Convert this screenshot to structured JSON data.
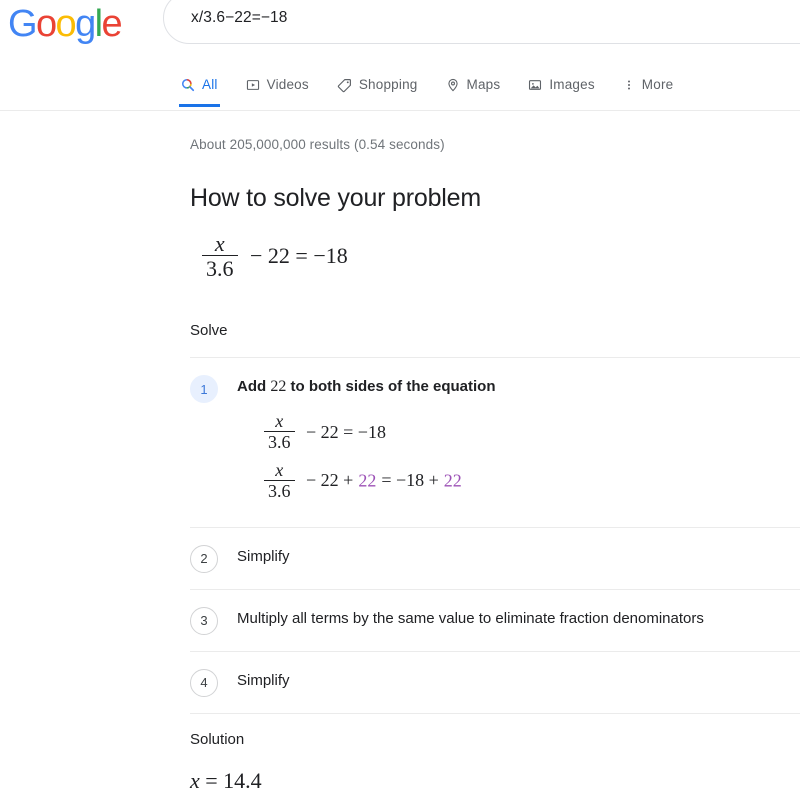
{
  "brand": {
    "name": "Google",
    "letters": [
      {
        "char": "G",
        "color": "#4285f4"
      },
      {
        "char": "o",
        "color": "#ea4335"
      },
      {
        "char": "o",
        "color": "#fbbc05"
      },
      {
        "char": "g",
        "color": "#4285f4"
      },
      {
        "char": "l",
        "color": "#34a853"
      },
      {
        "char": "e",
        "color": "#ea4335"
      }
    ]
  },
  "search": {
    "query": "x/3.6−22=−18",
    "placeholder": "Search"
  },
  "nav": {
    "tabs": [
      {
        "label": "All",
        "icon": "search-icon",
        "active": true
      },
      {
        "label": "Videos",
        "icon": "video-icon",
        "active": false
      },
      {
        "label": "Shopping",
        "icon": "tag-icon",
        "active": false
      },
      {
        "label": "Maps",
        "icon": "map-pin-icon",
        "active": false
      },
      {
        "label": "Images",
        "icon": "image-icon",
        "active": false
      },
      {
        "label": "More",
        "icon": "more-vertical-icon",
        "active": false
      }
    ],
    "active_color": "#1a73e8"
  },
  "results": {
    "stats": "About 205,000,000 results (0.54 seconds)"
  },
  "answer": {
    "title": "How to solve your problem",
    "equation": {
      "numerator": "x",
      "denominator": "3.6",
      "rest": "− 22 = −18"
    },
    "solve_label": "Solve",
    "solution_label": "Solution",
    "solution_value": "x = 14.4",
    "highlight_color": "#9c51b6",
    "steps": [
      {
        "number": "1",
        "title_prefix": "Add ",
        "title_value": "22",
        "title_suffix": " to both sides of the equation",
        "expanded": true,
        "equations": [
          {
            "numerator": "x",
            "denominator": "3.6",
            "rest": "− 22 = −18",
            "highlighted": false
          },
          {
            "numerator": "x",
            "denominator": "3.6",
            "part1": "− 22 +",
            "hl1": "22",
            "part2": "= −18 +",
            "hl2": "22",
            "highlighted": true
          }
        ]
      },
      {
        "number": "2",
        "title": "Simplify",
        "expanded": false
      },
      {
        "number": "3",
        "title": "Multiply all terms by the same value to eliminate fraction denominators",
        "expanded": false
      },
      {
        "number": "4",
        "title": "Simplify",
        "expanded": false
      }
    ]
  }
}
